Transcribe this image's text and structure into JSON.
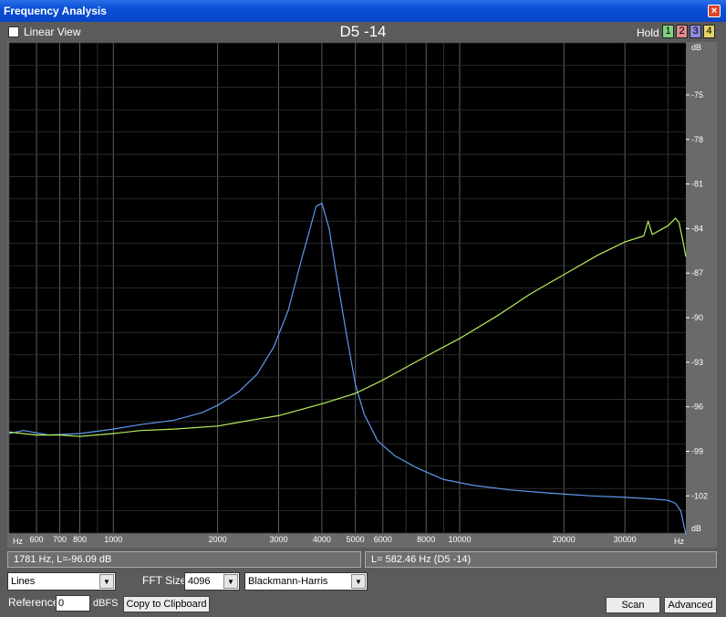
{
  "window": {
    "title": "Frequency Analysis",
    "close_glyph": "×"
  },
  "toolbar": {
    "linear_view_label": "Linear View",
    "graph_title": "D5 -14",
    "hold_label": "Hold",
    "hold_buttons": [
      {
        "label": "1",
        "color": "#7fd27f"
      },
      {
        "label": "2",
        "color": "#e08a8a"
      },
      {
        "label": "3",
        "color": "#8a8ae0"
      },
      {
        "label": "4",
        "color": "#e0d46a"
      }
    ]
  },
  "chart_data": {
    "type": "line",
    "x_scale": "log",
    "xlim": [
      500,
      45000
    ],
    "ylim": [
      -104.5,
      -71.5
    ],
    "x_unit_left": "Hz",
    "x_unit_right": "Hz",
    "y_unit_top": "dB",
    "y_unit_bottom": "dB",
    "x_tick_labels": [
      {
        "value": 600,
        "label": "600"
      },
      {
        "value": 700,
        "label": "700"
      },
      {
        "value": 800,
        "label": "800"
      },
      {
        "value": 1000,
        "label": "1000"
      },
      {
        "value": 2000,
        "label": "2000"
      },
      {
        "value": 3000,
        "label": "3000"
      },
      {
        "value": 4000,
        "label": "4000"
      },
      {
        "value": 5000,
        "label": "5000"
      },
      {
        "value": 6000,
        "label": "6000"
      },
      {
        "value": 8000,
        "label": "8000"
      },
      {
        "value": 10000,
        "label": "10000"
      },
      {
        "value": 20000,
        "label": "20000"
      },
      {
        "value": 30000,
        "label": "30000"
      }
    ],
    "y_tick_labels": [
      {
        "value": -75,
        "label": "-75"
      },
      {
        "value": -78,
        "label": "-78"
      },
      {
        "value": -81,
        "label": "-81"
      },
      {
        "value": -84,
        "label": "-84"
      },
      {
        "value": -87,
        "label": "-87"
      },
      {
        "value": -90,
        "label": "-90"
      },
      {
        "value": -93,
        "label": "-93"
      },
      {
        "value": -96,
        "label": "-96"
      },
      {
        "value": -99,
        "label": "-99"
      },
      {
        "value": -102,
        "label": "-102"
      }
    ],
    "grid": true,
    "series": [
      {
        "color": "#5b9bf0",
        "x": [
          500,
          550,
          650,
          800,
          1000,
          1200,
          1500,
          1800,
          2000,
          2300,
          2600,
          2900,
          3200,
          3500,
          3700,
          3850,
          4000,
          4200,
          4400,
          4700,
          5000,
          5300,
          5800,
          6500,
          7500,
          9000,
          11000,
          14000,
          18000,
          24000,
          30000,
          36000,
          40000,
          42000,
          43500,
          45000
        ],
        "y": [
          -97.8,
          -97.6,
          -97.9,
          -97.8,
          -97.5,
          -97.2,
          -96.9,
          -96.4,
          -95.9,
          -95,
          -93.8,
          -92,
          -89.5,
          -86,
          -84,
          -82.5,
          -82.3,
          -84,
          -87,
          -91,
          -94.5,
          -96.5,
          -98.3,
          -99.3,
          -100.1,
          -100.9,
          -101.3,
          -101.6,
          -101.8,
          -102,
          -102.1,
          -102.2,
          -102.3,
          -102.5,
          -103,
          -104.6
        ]
      },
      {
        "color": "#b6f05a",
        "x": [
          500,
          600,
          700,
          800,
          1000,
          1200,
          1500,
          2000,
          2500,
          3000,
          4000,
          5000,
          6000,
          8000,
          10000,
          13000,
          16000,
          20000,
          25000,
          30000,
          34000,
          35000,
          36000,
          40000,
          42000,
          43000,
          44000,
          45000
        ],
        "y": [
          -97.7,
          -97.9,
          -97.9,
          -98,
          -97.8,
          -97.6,
          -97.5,
          -97.3,
          -96.9,
          -96.6,
          -95.8,
          -95.1,
          -94.2,
          -92.6,
          -91.4,
          -89.8,
          -88.4,
          -87.1,
          -85.8,
          -84.9,
          -84.5,
          -83.5,
          -84.4,
          -83.8,
          -83.3,
          -83.6,
          -84.7,
          -85.9
        ]
      }
    ]
  },
  "status": {
    "cursor_readout": "1781 Hz, L=-96.09 dB",
    "peak_readout": "L= 582.46 Hz (D5 -14)"
  },
  "controls": {
    "display_mode": "Lines",
    "fft_size_label": "FFT Size",
    "fft_size": "4096",
    "window_function": "Blackmann-Harris",
    "reference_label": "Reference",
    "reference_value": "0",
    "reference_unit": "dBFS",
    "copy_label": "Copy to Clipboard",
    "scan_label": "Scan",
    "advanced_label": "Advanced",
    "dropdown_glyph": "▼"
  }
}
